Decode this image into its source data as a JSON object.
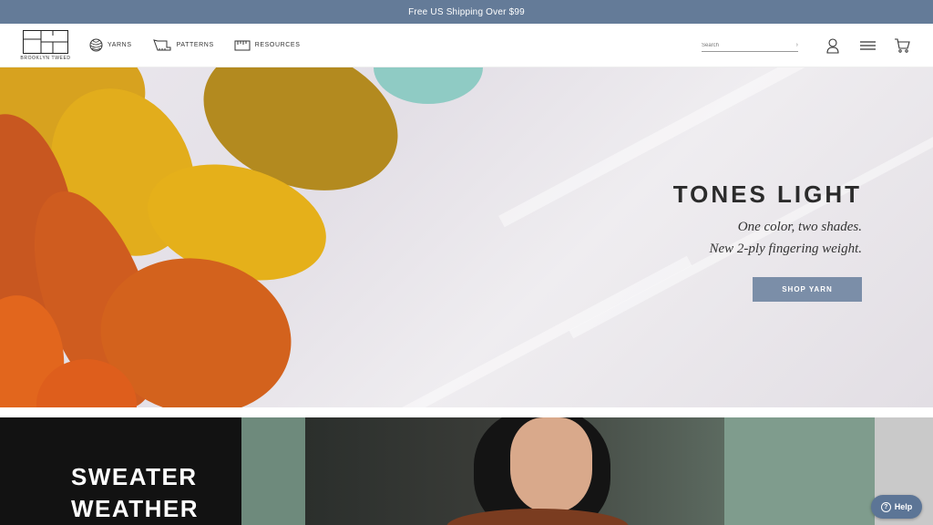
{
  "promo": {
    "text": "Free US Shipping Over $99"
  },
  "header": {
    "logo_text": "BROOKLYN TWEED",
    "nav": [
      {
        "label": "YARNS",
        "icon": "yarn-ball-icon"
      },
      {
        "label": "PATTERNS",
        "icon": "pattern-icon"
      },
      {
        "label": "RESOURCES",
        "icon": "ruler-icon"
      }
    ],
    "search": {
      "placeholder": "Search",
      "submit": "›"
    },
    "icons": [
      "account-icon",
      "menu-icon",
      "cart-icon"
    ]
  },
  "hero": {
    "title": "TONES LIGHT",
    "subtitle_line1": "One color, two shades.",
    "subtitle_line2": "New 2-ply fingering weight.",
    "button": "SHOP YARN"
  },
  "section2": {
    "title_line1": "SWEATER",
    "title_line2": "WEATHER"
  },
  "help": {
    "label": "Help",
    "icon_glyph": "?"
  },
  "colors": {
    "promo_bg": "#647b98",
    "button_bg": "#7b8ea8",
    "help_bg": "#5c7596"
  }
}
